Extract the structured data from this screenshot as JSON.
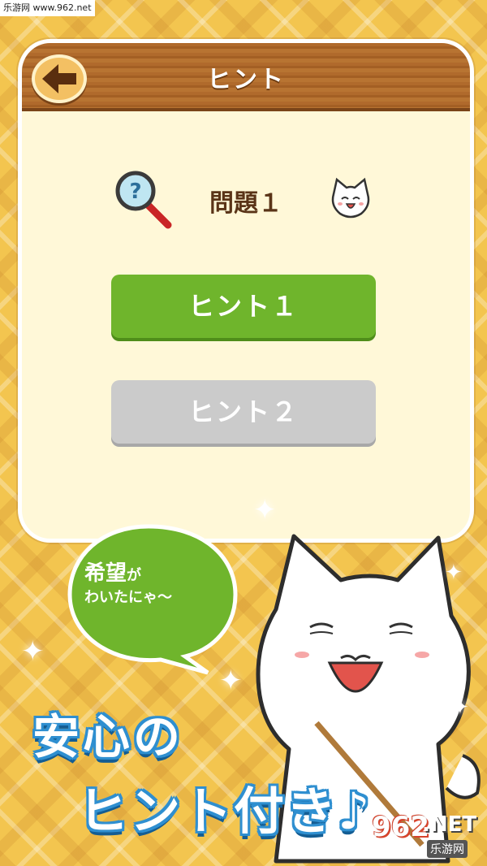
{
  "watermark": "乐游网 www.962.net",
  "header": {
    "title": "ヒント",
    "back_icon": "arrow-left-icon"
  },
  "question": {
    "label": "問題１",
    "magnifier_icon": "magnifier-question-icon",
    "cat_icon": "cat-face-icon"
  },
  "hints": [
    {
      "label": "ヒント１",
      "state": "available",
      "color": "#6fb52c"
    },
    {
      "label": "ヒント２",
      "state": "locked",
      "color": "#cbcbcb"
    }
  ],
  "bubble": {
    "line1_big": "希望",
    "line1_small": "が",
    "line2": "わいたにゃ〜"
  },
  "slogan": {
    "line1": "安心の",
    "line2": "ヒント付き♪"
  },
  "site_logo": {
    "number": "962",
    "suffix": ".NET",
    "chinese": "乐游网"
  },
  "colors": {
    "background": "#f3c54f",
    "panel": "#fff8d8",
    "header_wood": "#b06a2c",
    "accent_green": "#6fb52c",
    "slogan_outline": "#2f8fd0"
  }
}
